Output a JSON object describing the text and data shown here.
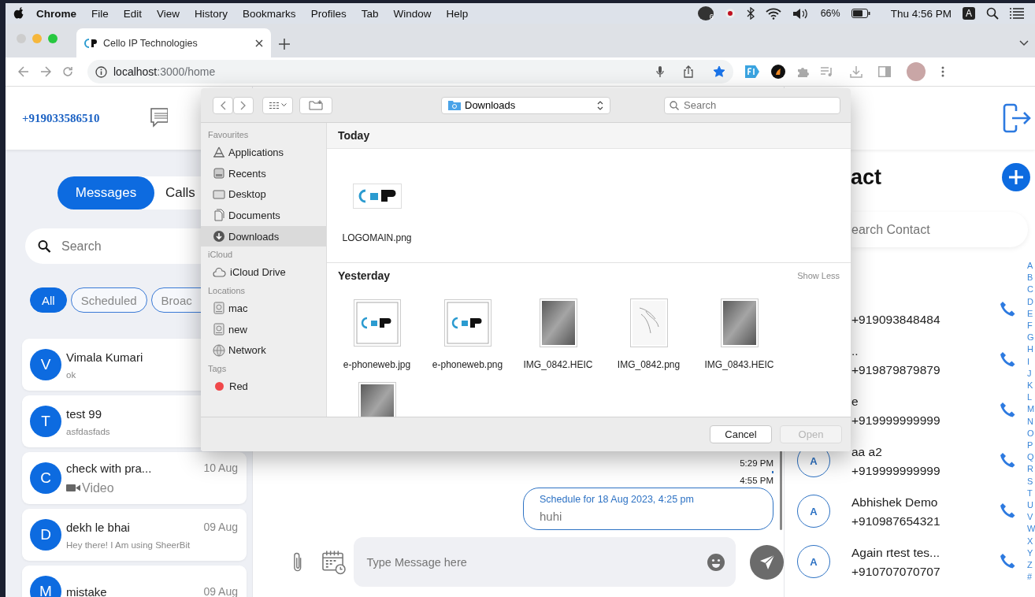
{
  "menu_bar": {
    "app": "Chrome",
    "menus": [
      "File",
      "Edit",
      "View",
      "History",
      "Bookmarks",
      "Profiles",
      "Tab",
      "Window",
      "Help"
    ],
    "badge": "6",
    "battery": "66%",
    "clock": "Thu 4:56 PM",
    "input_source": "A"
  },
  "browser": {
    "tabs": [
      {
        "title": "Cello IP Technologies",
        "selected": true
      }
    ],
    "url_host": "localhost",
    "url_path": ":3000/home",
    "bookmarked": true
  },
  "app": {
    "phone_number": "+919033586510",
    "view_tabs": [
      {
        "label": "Messages",
        "selected": true
      },
      {
        "label": "Calls",
        "selected": false
      }
    ],
    "search": {
      "placeholder": "Search"
    },
    "filters": [
      {
        "label": "All",
        "selected": true
      },
      {
        "label": "Scheduled",
        "selected": false
      },
      {
        "label": "Broac",
        "selected": false
      }
    ],
    "conversations": [
      {
        "initial": "V",
        "name": "Vimala Kumari",
        "kind": "text",
        "preview": "ok"
      },
      {
        "initial": "T",
        "name": "test 99",
        "kind": "text",
        "preview": "asfdasfads"
      },
      {
        "initial": "C",
        "name": "check with pra...",
        "kind": "video",
        "preview": "Video",
        "date": "10 Aug"
      },
      {
        "initial": "D",
        "name": "dekh le bhai",
        "kind": "text",
        "preview": "Hey there! I Am using SheerBit",
        "date": "09 Aug"
      },
      {
        "initial": "M",
        "name": "mistake",
        "kind": "text",
        "date": "09 Aug"
      }
    ],
    "chat": {
      "times": [
        "5:29 PM",
        "4:55 PM"
      ],
      "scheduled_message": {
        "schedule": "Schedule for 18 Aug 2023, 4:25 pm",
        "text": "huhi"
      },
      "composer": {
        "placeholder": "Type Message here"
      }
    },
    "contacts": {
      "title": "act",
      "search_placeholder": "earch Contact",
      "items": [
        {
          "phone": "+919093848484"
        },
        {
          "name": "..",
          "phone": "+919879879879"
        },
        {
          "name": "e",
          "phone": "+919999999999"
        },
        {
          "avatar": "A",
          "name": "aa a2",
          "phone": "+919999999999"
        },
        {
          "avatar": "A",
          "name": "Abhishek Demo",
          "phone": "+910987654321"
        },
        {
          "avatar": "A",
          "name": "Again rtest tes...",
          "phone": "+910707070707"
        }
      ],
      "index": [
        "A",
        "B",
        "C",
        "D",
        "E",
        "F",
        "G",
        "H",
        "I",
        "J",
        "K",
        "L",
        "M",
        "N",
        "O",
        "P",
        "Q",
        "R",
        "S",
        "T",
        "U",
        "V",
        "W",
        "X",
        "Y",
        "Z",
        "#"
      ]
    }
  },
  "file_dialog": {
    "location": "Downloads",
    "search_placeholder": "Search",
    "sidebar": [
      {
        "heading": "Favourites",
        "items": [
          {
            "label": "Applications",
            "kind": "apps",
            "selected": false
          },
          {
            "label": "Recents",
            "kind": "recents",
            "selected": false
          },
          {
            "label": "Desktop",
            "kind": "desktop",
            "selected": false
          },
          {
            "label": "Documents",
            "kind": "documents",
            "selected": false
          },
          {
            "label": "Downloads",
            "kind": "downloads",
            "selected": true
          }
        ]
      },
      {
        "heading": "iCloud",
        "items": [
          {
            "label": "iCloud Drive",
            "kind": "cloud",
            "selected": false
          }
        ]
      },
      {
        "heading": "Locations",
        "items": [
          {
            "label": "mac",
            "kind": "disk",
            "selected": false
          },
          {
            "label": "new",
            "kind": "disk",
            "selected": false
          },
          {
            "label": "Network",
            "kind": "network",
            "selected": false
          }
        ]
      },
      {
        "heading": "Tags",
        "items": [
          {
            "label": "Red",
            "kind": "tag",
            "color": "#f0484a",
            "selected": false
          }
        ]
      }
    ],
    "sections": [
      {
        "title": "Today",
        "files": [
          {
            "name": "LOGOMAIN.png",
            "kind": "logo"
          }
        ]
      },
      {
        "title": "Yesterday",
        "action": "Show Less",
        "files": [
          {
            "name": "e-phoneweb.jpg",
            "kind": "logo-framed"
          },
          {
            "name": "e-phoneweb.png",
            "kind": "logo-framed"
          },
          {
            "name": "IMG_0842.HEIC",
            "kind": "photo"
          },
          {
            "name": "IMG_0842.png",
            "kind": "sketch"
          },
          {
            "name": "IMG_0843.HEIC",
            "kind": "photo"
          },
          {
            "kind": "photo"
          }
        ]
      }
    ],
    "buttons": [
      {
        "label": "Cancel",
        "disabled": false
      },
      {
        "label": "Open",
        "disabled": true
      }
    ]
  }
}
